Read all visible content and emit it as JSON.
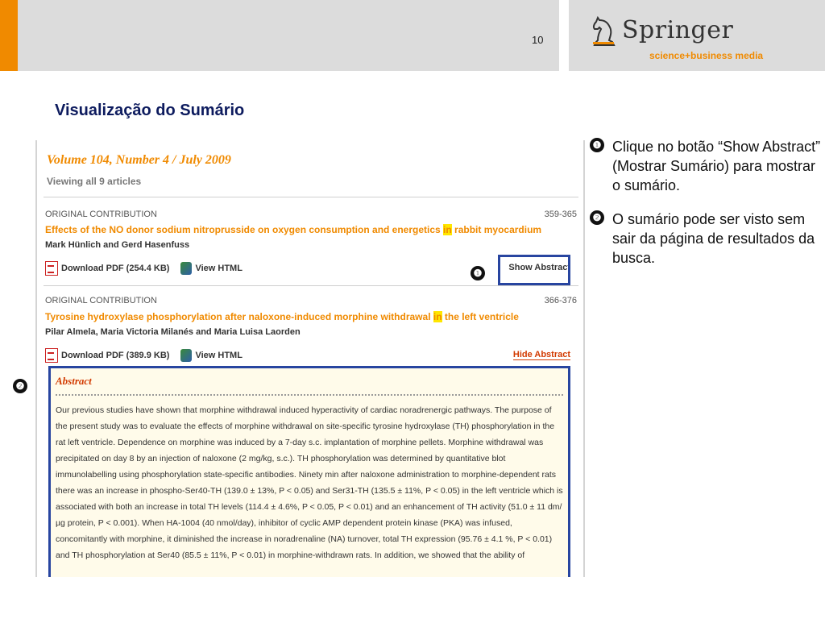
{
  "header": {
    "page_number": "10",
    "logo": {
      "brand": "Springer",
      "tagline": "science+business media"
    }
  },
  "slide_title": "Visualização do Sumário",
  "screenshot": {
    "volume_title": "Volume 104, Number 4 / July 2009",
    "viewing_text": "Viewing all 9 articles",
    "articles": [
      {
        "type": "ORIGINAL CONTRIBUTION",
        "pages": "359-365",
        "title_before": "Effects of the NO donor sodium nitroprusside on oxygen consumption and energetics ",
        "title_highlight": "in",
        "title_after": " rabbit myocardium",
        "authors": "Mark Hünlich and Gerd Hasenfuss",
        "download_pdf": "Download PDF (254.4 KB)",
        "view_html": "View HTML",
        "abstract_toggle": "Show Abstract"
      },
      {
        "type": "ORIGINAL CONTRIBUTION",
        "pages": "366-376",
        "title_before": "Tyrosine hydroxylase phosphorylation after naloxone-induced morphine withdrawal ",
        "title_highlight": "in",
        "title_after": " the left ventricle",
        "authors": "Pilar Almela, Maria Victoria Milanés and Maria Luisa Laorden",
        "download_pdf": "Download PDF (389.9 KB)",
        "view_html": "View HTML",
        "abstract_toggle": "Hide Abstract"
      }
    ],
    "abstract": {
      "heading": "Abstract",
      "text": "Our previous studies have shown that morphine withdrawal induced hyperactivity of cardiac noradrenergic pathways. The purpose of the present study was to evaluate the effects of morphine withdrawal on site-specific tyrosine hydroxylase (TH) phosphorylation in the rat left ventricle. Dependence on morphine was induced by a 7-day s.c. implantation of morphine pellets. Morphine withdrawal was precipitated on day 8 by an injection of naloxone (2 mg/kg, s.c.). TH phosphorylation was determined by quantitative blot immunolabelling using phosphorylation state-specific antibodies. Ninety min after naloxone administration to morphine-dependent rats there was an increase in phospho-Ser40-TH (139.0 ± 13%, P < 0.05) and Ser31-TH (135.5 ± 11%, P < 0.05) in the left ventricle which is associated with both an increase in total TH levels (114.4 ± 4.6%, P < 0.05, P < 0.01) and an enhancement of TH activity (51.0 ± 11 dm/µg protein, P < 0.001). When HA-1004 (40 nmol/day), inhibitor of cyclic AMP dependent protein kinase (PKA) was infused, concomitantly with morphine, it diminished the increase in noradrenaline (NA) turnover, total TH expression (95.76 ± 4.1 %, P < 0.01) and TH phosphorylation at Ser40 (85.5 ± 11%, P < 0.01) in morphine-withdrawn rats. In addition, we showed that the ability of"
    },
    "markers": [
      "❶",
      "❷"
    ]
  },
  "instructions": [
    {
      "marker": "❶",
      "text": "Clique no botão “Show Abstract” (Mostrar Sumário) para mostrar o sumário."
    },
    {
      "marker": "❷",
      "text": "O sumário pode ser visto sem sair da página de resultados da busca."
    }
  ]
}
